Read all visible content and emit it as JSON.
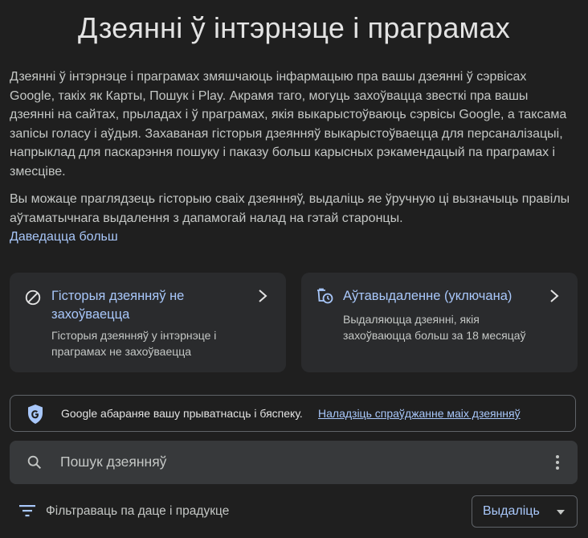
{
  "page": {
    "title": "Дзеянні ў інтэрнэце і праграмах"
  },
  "intro": {
    "paragraph1": "Дзеянні ў інтэрнэце і праграмах змяшчаюць інфармацыю пра вашы дзеянні ў сэрвісах Google, такіх як Карты, Пошук і Play. Акрамя таго, могуць захоўвацца звесткі пра вашы дзеянні на сайтах, прыладах і ў праграмах, якія выкарыстоўваюць сэрвісы Google, а таксама запісы голасу і аўдыя. Захаваная гісторыя дзеянняў выкарыстоўваецца для персаналізацыі, напрыклад для паскарэння пошуку і паказу больш карысных рэкамендацый па праграмах і змесціве.",
    "paragraph2": "Вы можаце праглядзець гісторыю сваіх дзеянняў, выдаліць яе ўручную ці вызначыць правілы аўтаматычнага выдалення з дапамогай налад на гэтай старонцы.",
    "learn_more": "Даведацца больш"
  },
  "cards": [
    {
      "icon": "block-icon",
      "title": "Гісторыя дзеянняў не захоўваецца",
      "description": "Гісторыя дзеянняў у інтэрнэце і праграмах не захоўваецца"
    },
    {
      "icon": "auto-delete-icon",
      "title": "Аўтавыдаленне (уключана)",
      "description": "Выдаляюцца дзеянні, якія захоўваюцца больш за 18 месяцаў"
    }
  ],
  "protection": {
    "text": "Google абараняе вашу прыватнасць і бяспеку.",
    "link": "Наладзіць спраўджанне маіх дзеянняў"
  },
  "search": {
    "placeholder": "Пошук дзеянняў"
  },
  "filter": {
    "label": "Фільтраваць па даце і прадукце"
  },
  "delete_button": {
    "label": "Выдаліць"
  },
  "colors": {
    "background": "#1f1f1f",
    "card": "#2a2b2d",
    "accent": "#a8c7fa",
    "text": "#e3e3e3",
    "muted": "#c4c7c5"
  }
}
